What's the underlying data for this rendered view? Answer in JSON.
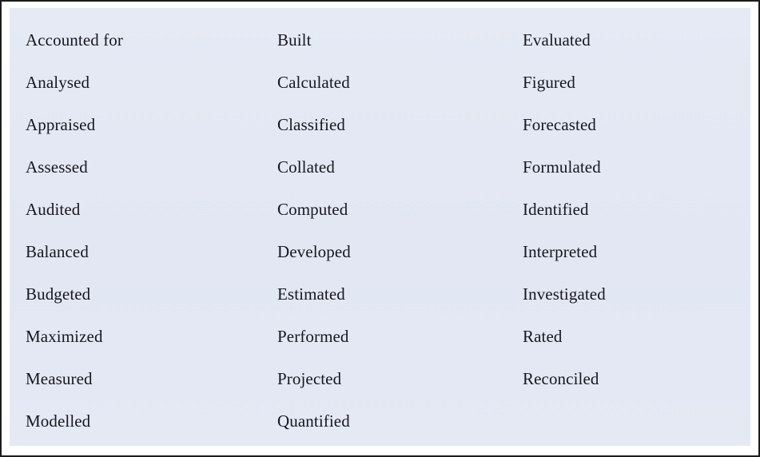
{
  "panel": {
    "background_color": "#e3e8f4",
    "border_color": "#1c1c1c",
    "text_color": "#17171f"
  },
  "table": {
    "type": "table",
    "columns": 3,
    "rows": 10,
    "column_1": [
      "Accounted for",
      "Analysed",
      "Appraised",
      "Assessed",
      "Audited",
      "Balanced",
      "Budgeted",
      "Maximized",
      "Measured",
      "Modelled"
    ],
    "column_2": [
      "Built",
      "Calculated",
      "Classified",
      "Collated",
      "Computed",
      "Developed",
      "Estimated",
      "Performed",
      "Projected",
      "Quantified"
    ],
    "column_3": [
      "Evaluated",
      "Figured",
      "Forecasted",
      "Formulated",
      "Identified",
      "Interpreted",
      "Investigated",
      "Rated",
      "Reconciled",
      ""
    ]
  }
}
